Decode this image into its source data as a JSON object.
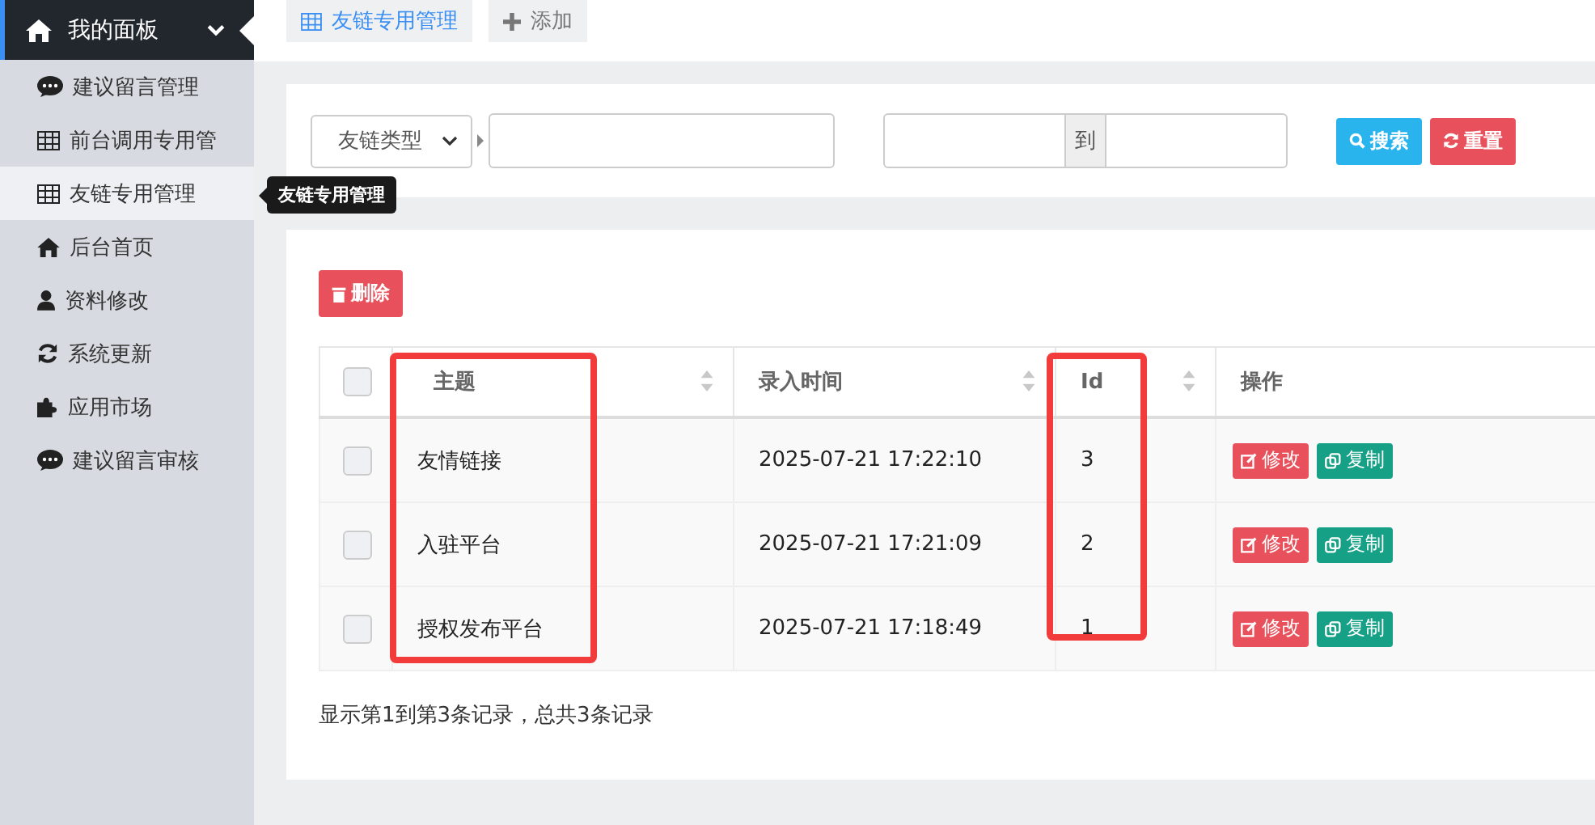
{
  "sidebar": {
    "header": {
      "label": "我的面板",
      "expanded": true
    },
    "items": [
      {
        "label": "建议留言管理",
        "kind": "comment",
        "selected": false
      },
      {
        "label": "前台调用专用管",
        "kind": "table",
        "selected": false
      },
      {
        "label": "友链专用管理",
        "kind": "table",
        "selected": true
      },
      {
        "label": "后台首页",
        "kind": "home",
        "selected": false
      },
      {
        "label": "资料修改",
        "kind": "user",
        "selected": false
      },
      {
        "label": "系统更新",
        "kind": "refresh",
        "selected": false
      },
      {
        "label": "应用市场",
        "kind": "puzzle",
        "selected": false
      },
      {
        "label": "建议留言审核",
        "kind": "comment",
        "selected": false
      }
    ],
    "tooltip": "友链专用管理"
  },
  "tabs": [
    {
      "label": "友链专用管理",
      "kind": "table",
      "selected": true
    },
    {
      "label": "添加",
      "kind": "plus",
      "selected": false
    }
  ],
  "search": {
    "type_select": "友链类型",
    "date_separator": "到",
    "search_button": "搜索",
    "reset_button": "重置"
  },
  "delete_button": "删除",
  "table": {
    "header_checked": false,
    "columns": [
      {
        "label": "主题",
        "sortable": true,
        "highlighted": true
      },
      {
        "label": "录入时间",
        "sortable": true,
        "highlighted": false
      },
      {
        "label": "Id",
        "sortable": true,
        "highlighted": true
      },
      {
        "label": "操作",
        "sortable": false,
        "highlighted": false
      }
    ],
    "rows": [
      {
        "checked": false,
        "cells": [
          "友情链接",
          "2025-07-21 17:22:10",
          "3"
        ],
        "edit": "修改",
        "copy": "复制"
      },
      {
        "checked": false,
        "cells": [
          "入驻平台",
          "2025-07-21 17:21:09",
          "2"
        ],
        "edit": "修改",
        "copy": "复制"
      },
      {
        "checked": false,
        "cells": [
          "授权发布平台",
          "2025-07-21 17:18:49",
          "1"
        ],
        "edit": "修改",
        "copy": "复制"
      }
    ]
  },
  "footer": "显示第1到第3条记录，总共3条记录"
}
